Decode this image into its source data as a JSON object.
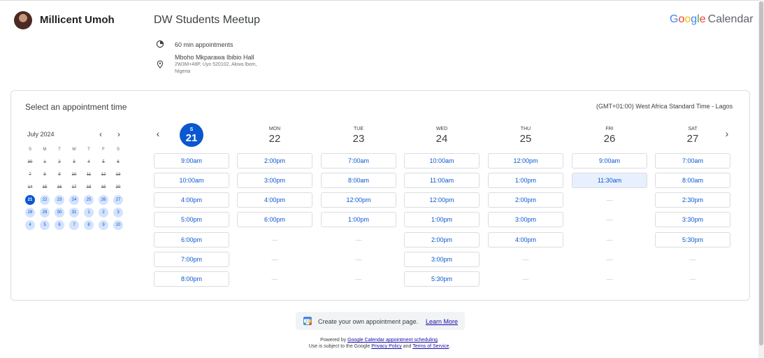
{
  "host": {
    "name": "Millicent Umoh"
  },
  "event": {
    "title": "DW Students Meetup",
    "duration": "60 min appointments",
    "location_name": "Mboho Mkparawa Ibibio Hall",
    "location_address": "2W3M+48P, Uyo 520102, Akwa Ibom, Nigeria"
  },
  "brand": {
    "google": [
      "G",
      "o",
      "o",
      "g",
      "l",
      "e"
    ],
    "product": "Calendar"
  },
  "card": {
    "title": "Select an appointment time",
    "timezone": "(GMT+01:00) West Africa Standard Time - Lagos"
  },
  "mini_calendar": {
    "month": "July 2024",
    "prev": "‹",
    "next": "›",
    "weekdays": [
      "S",
      "M",
      "T",
      "W",
      "T",
      "F",
      "S"
    ],
    "weeks": [
      [
        {
          "d": "30",
          "s": "past"
        },
        {
          "d": "1",
          "s": "past"
        },
        {
          "d": "2",
          "s": "past"
        },
        {
          "d": "3",
          "s": "past"
        },
        {
          "d": "4",
          "s": "past"
        },
        {
          "d": "5",
          "s": "past"
        },
        {
          "d": "6",
          "s": "past"
        }
      ],
      [
        {
          "d": "7",
          "s": "past"
        },
        {
          "d": "8",
          "s": "past"
        },
        {
          "d": "9",
          "s": "past"
        },
        {
          "d": "10",
          "s": "past"
        },
        {
          "d": "11",
          "s": "past"
        },
        {
          "d": "12",
          "s": "past"
        },
        {
          "d": "13",
          "s": "past"
        }
      ],
      [
        {
          "d": "14",
          "s": "past"
        },
        {
          "d": "15",
          "s": "past"
        },
        {
          "d": "16",
          "s": "past"
        },
        {
          "d": "17",
          "s": "past"
        },
        {
          "d": "18",
          "s": "past"
        },
        {
          "d": "19",
          "s": "past"
        },
        {
          "d": "20",
          "s": "past"
        }
      ],
      [
        {
          "d": "21",
          "s": "sel"
        },
        {
          "d": "22",
          "s": "avail"
        },
        {
          "d": "23",
          "s": "avail"
        },
        {
          "d": "24",
          "s": "avail"
        },
        {
          "d": "25",
          "s": "avail"
        },
        {
          "d": "26",
          "s": "avail"
        },
        {
          "d": "27",
          "s": "avail"
        }
      ],
      [
        {
          "d": "28",
          "s": "avail"
        },
        {
          "d": "29",
          "s": "avail"
        },
        {
          "d": "30",
          "s": "avail"
        },
        {
          "d": "31",
          "s": "avail"
        },
        {
          "d": "1",
          "s": "avail"
        },
        {
          "d": "2",
          "s": "avail"
        },
        {
          "d": "3",
          "s": "avail"
        }
      ],
      [
        {
          "d": "4",
          "s": "avail"
        },
        {
          "d": "5",
          "s": "avail"
        },
        {
          "d": "6",
          "s": "avail"
        },
        {
          "d": "7",
          "s": "avail"
        },
        {
          "d": "8",
          "s": "avail"
        },
        {
          "d": "9",
          "s": "avail"
        },
        {
          "d": "10",
          "s": "avail"
        }
      ]
    ]
  },
  "week_nav": {
    "prev": "‹",
    "next": "›"
  },
  "days": [
    {
      "dow": "S",
      "num": "21",
      "selected": true,
      "slots": [
        "9:00am",
        "10:00am",
        "4:00pm",
        "5:00pm",
        "6:00pm",
        "7:00pm",
        "8:00pm"
      ]
    },
    {
      "dow": "MON",
      "num": "22",
      "slots": [
        "2:00pm",
        "3:00pm",
        "4:00pm",
        "6:00pm"
      ]
    },
    {
      "dow": "TUE",
      "num": "23",
      "slots": [
        "7:00am",
        "8:00am",
        "12:00pm",
        "1:00pm"
      ]
    },
    {
      "dow": "WED",
      "num": "24",
      "slots": [
        "10:00am",
        "11:00am",
        "12:00pm",
        "1:00pm",
        "2:00pm",
        "3:00pm",
        "5:30pm"
      ]
    },
    {
      "dow": "THU",
      "num": "25",
      "slots": [
        "12:00pm",
        "1:00pm",
        "2:00pm",
        "3:00pm",
        "4:00pm"
      ]
    },
    {
      "dow": "FRI",
      "num": "26",
      "slots": [
        "9:00am",
        "11:30am"
      ],
      "highlight": 1
    },
    {
      "dow": "SAT",
      "num": "27",
      "slots": [
        "7:00am",
        "8:00am",
        "2:30pm",
        "3:30pm",
        "5:30pm"
      ]
    }
  ],
  "empty_slot": "—",
  "promo": {
    "text": "Create your own appointment page.",
    "link": "Learn More"
  },
  "footer": {
    "powered_prefix": "Powered by ",
    "powered_link": "Google Calendar appointment scheduling",
    "powered_suffix": ".",
    "terms_prefix": "Use is subject to the Google ",
    "privacy_link": "Privacy Policy",
    "and": " and ",
    "terms_link": "Terms of Service",
    "terms_suffix": "."
  },
  "colors": {
    "accent": "#0b57d0",
    "available": "#d3e3fd",
    "border": "#dadce0"
  }
}
